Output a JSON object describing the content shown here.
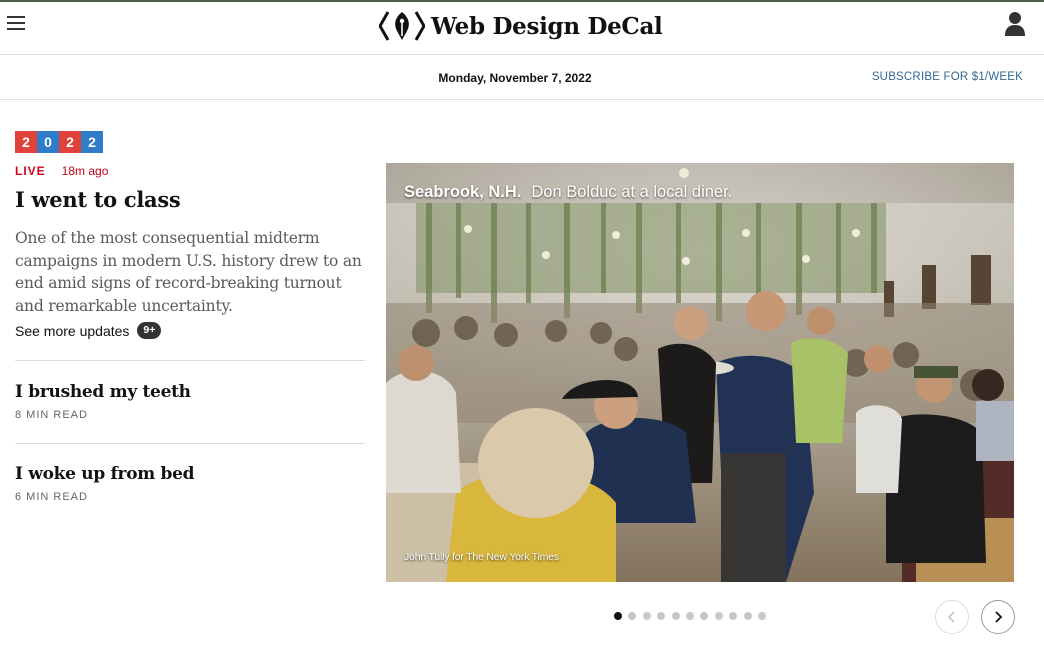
{
  "header": {
    "site_title": "Web Design DeCal",
    "menu_icon": "hamburger-menu-icon",
    "logo_icon": "pen-nib-code-icon",
    "account_icon": "user-icon"
  },
  "datebar": {
    "date": "Monday, November 7, 2022",
    "subscribe": "SUBSCRIBE FOR $1/WEEK"
  },
  "election_badge": [
    "2",
    "0",
    "2",
    "2"
  ],
  "lead": {
    "live_label": "LIVE",
    "time_ago": "18m ago",
    "headline": "I went to class",
    "summary": "One of the most consequential midterm campaigns in modern U.S. history drew to an end amid signs of record-breaking turnout and remarkable uncertainty.",
    "see_more": "See more updates",
    "update_count": "9+"
  },
  "stories": [
    {
      "title": "I brushed my teeth",
      "meta": "8 MIN READ"
    },
    {
      "title": "I woke up from bed",
      "meta": "6 MIN READ"
    }
  ],
  "hero": {
    "caption_place": "Seabrook, N.H.",
    "caption_text": "Don Bolduc at a local diner.",
    "credit": "John Tully for The New York Times"
  },
  "carousel": {
    "slide_count": 11,
    "active_index": 0,
    "prev_icon": "chevron-left-icon",
    "next_icon": "chevron-right-icon"
  },
  "colors": {
    "live_red": "#d0021b",
    "badge_red": "#e0413a",
    "badge_blue": "#2f7dc9",
    "link_blue": "#326891"
  }
}
